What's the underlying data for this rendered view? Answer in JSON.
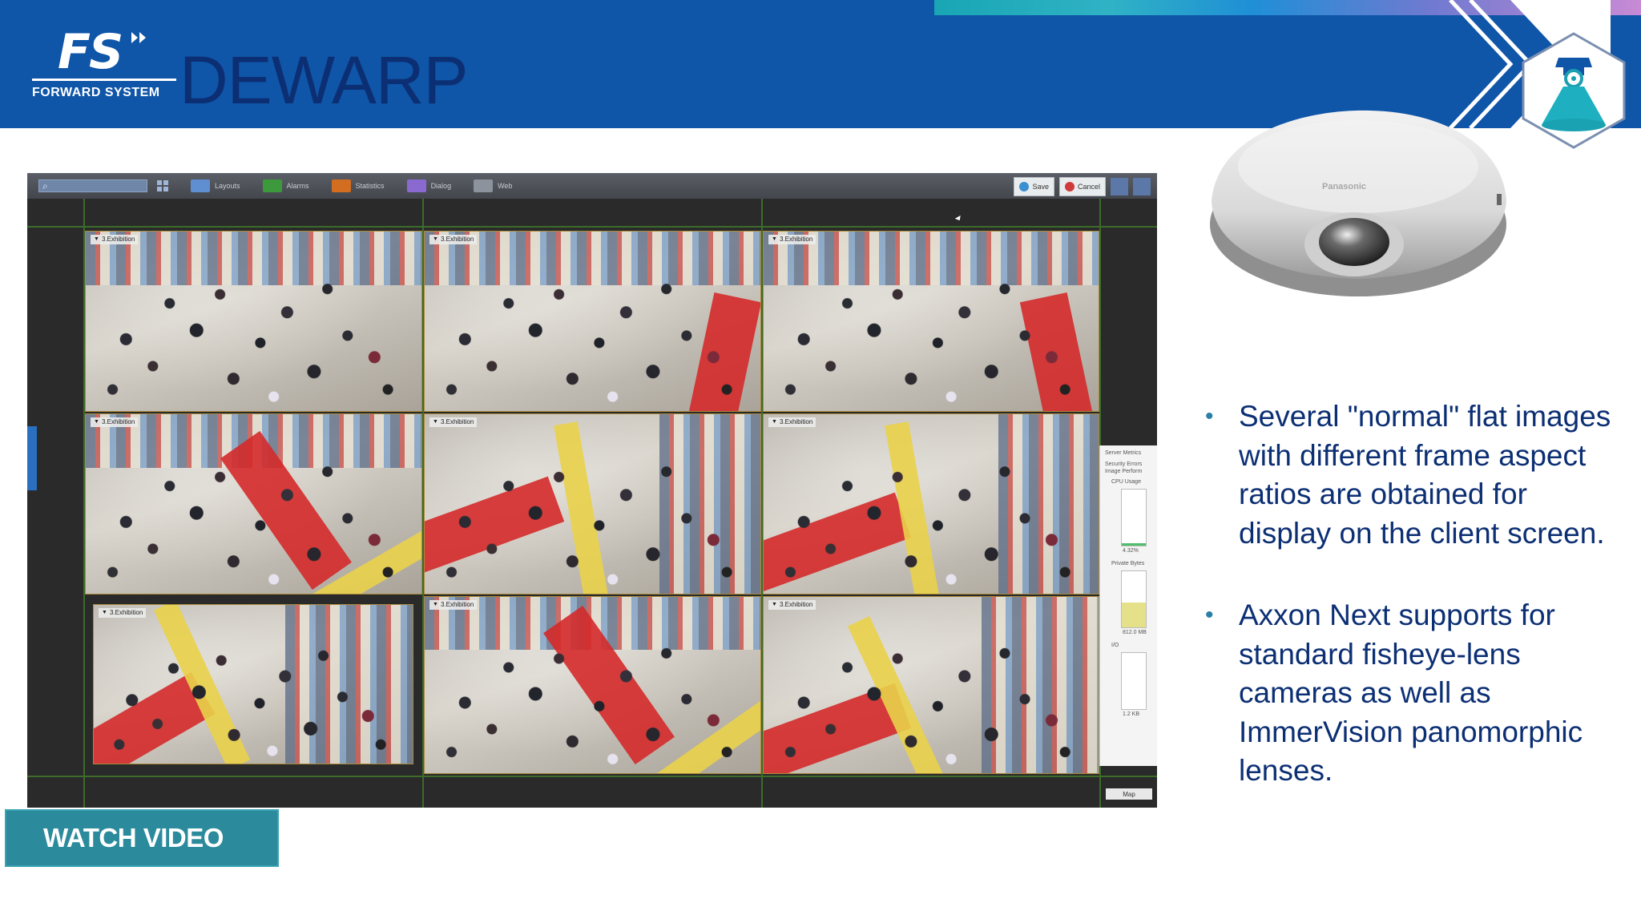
{
  "header": {
    "logo_letters": "FS",
    "logo_name": "FORWARD SYSTEM",
    "title": "DEWARP"
  },
  "vms": {
    "search_placeholder": "",
    "toolbar_items": [
      "Layouts",
      "Alarms",
      "Statistics",
      "Dialog",
      "Web"
    ],
    "save_label": "Save",
    "cancel_label": "Cancel",
    "tile_label": "3.Exhibition",
    "monitor": {
      "title": "Server Metrics",
      "tabs_row1": "Security   Errors",
      "tabs_row2": "Image      Perform",
      "cpu_label": "CPU Usage",
      "cpu_value": "4.32%",
      "cpu_fraction": 0.04,
      "private_label": "Private Bytes",
      "private_value": "812.0 MB",
      "private_fraction": 0.45,
      "io_label": "I/O",
      "io_value": "1.2 KB",
      "io_fraction": 0.0
    },
    "map_label": "Map"
  },
  "bullets": [
    "Several \"normal\" flat images with different frame aspect ratios are obtained for display on the client screen.",
    "Axxon Next supports for standard fisheye-lens cameras as well as ImmerVision panomorphic lenses."
  ],
  "camera_brand": "Panasonic",
  "watch_video_label": "WATCH VIDEO",
  "colors": {
    "header_blue": "#0f55a8",
    "title_navy": "#0c2f74",
    "button_teal": "#2b8a9b"
  }
}
